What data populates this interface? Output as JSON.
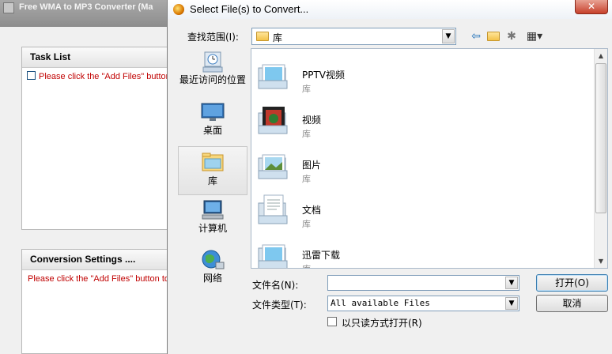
{
  "app": {
    "title": "Free WMA to MP3 Converter  (Ma",
    "task_list": {
      "header": "Task List",
      "hint": "Please click the \"Add Files\" button"
    },
    "conversion": {
      "header": "Conversion Settings ....",
      "hint": "Please click the \"Add Files\" button to"
    }
  },
  "dialog": {
    "title": "Select File(s) to Convert...",
    "close_symbol": "✕",
    "look_in_label": "查找范围(I):",
    "look_in_value": "库",
    "places": [
      {
        "label": "最近访问的位置",
        "icon": "recent-places-icon"
      },
      {
        "label": "桌面",
        "icon": "desktop-icon"
      },
      {
        "label": "库",
        "icon": "libraries-icon",
        "selected": true
      },
      {
        "label": "计算机",
        "icon": "computer-icon"
      },
      {
        "label": "网络",
        "icon": "network-icon"
      }
    ],
    "files": [
      {
        "name": "PPTV视频",
        "type": "库",
        "icon": "pptv-library-icon"
      },
      {
        "name": "视频",
        "type": "库",
        "icon": "videos-library-icon"
      },
      {
        "name": "图片",
        "type": "库",
        "icon": "pictures-library-icon"
      },
      {
        "name": "文档",
        "type": "库",
        "icon": "documents-library-icon"
      },
      {
        "name": "迅雷下载",
        "type": "库",
        "icon": "xunlei-library-icon"
      }
    ],
    "filename_label": "文件名(N):",
    "filename_value": "",
    "filetype_label": "文件类型(T):",
    "filetype_value": "All available Files",
    "readonly_label": "以只读方式打开(R)",
    "open_label": "打开(O)",
    "cancel_label": "取消"
  }
}
